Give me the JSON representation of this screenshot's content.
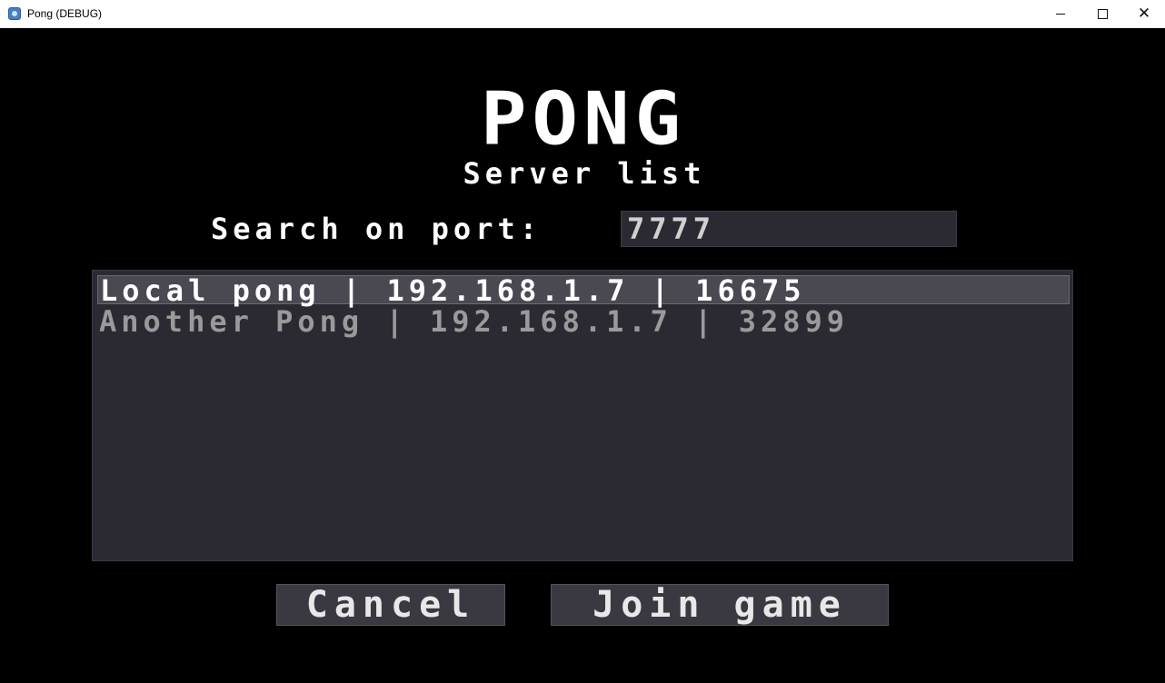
{
  "window": {
    "title": "Pong (DEBUG)",
    "controls": {
      "minimize": "–",
      "maximize": "□",
      "close": "✕"
    },
    "app_icon": "godot-icon"
  },
  "header": {
    "title": "PONG",
    "subtitle": "Server list"
  },
  "search": {
    "label": "Search on port:",
    "port_value": "7777"
  },
  "servers": [
    {
      "text": "Local pong | 192.168.1.7 | 16675",
      "selected": true
    },
    {
      "text": "Another Pong | 192.168.1.7 | 32899",
      "selected": false
    }
  ],
  "actions": {
    "cancel_label": "Cancel",
    "join_label": "Join game"
  },
  "colors": {
    "background": "#000000",
    "panel": "#2b2a33",
    "selected_row": "#4a4952",
    "button": "#3a3941",
    "text": "#ffffff",
    "text_dim": "#9a9a9a"
  }
}
